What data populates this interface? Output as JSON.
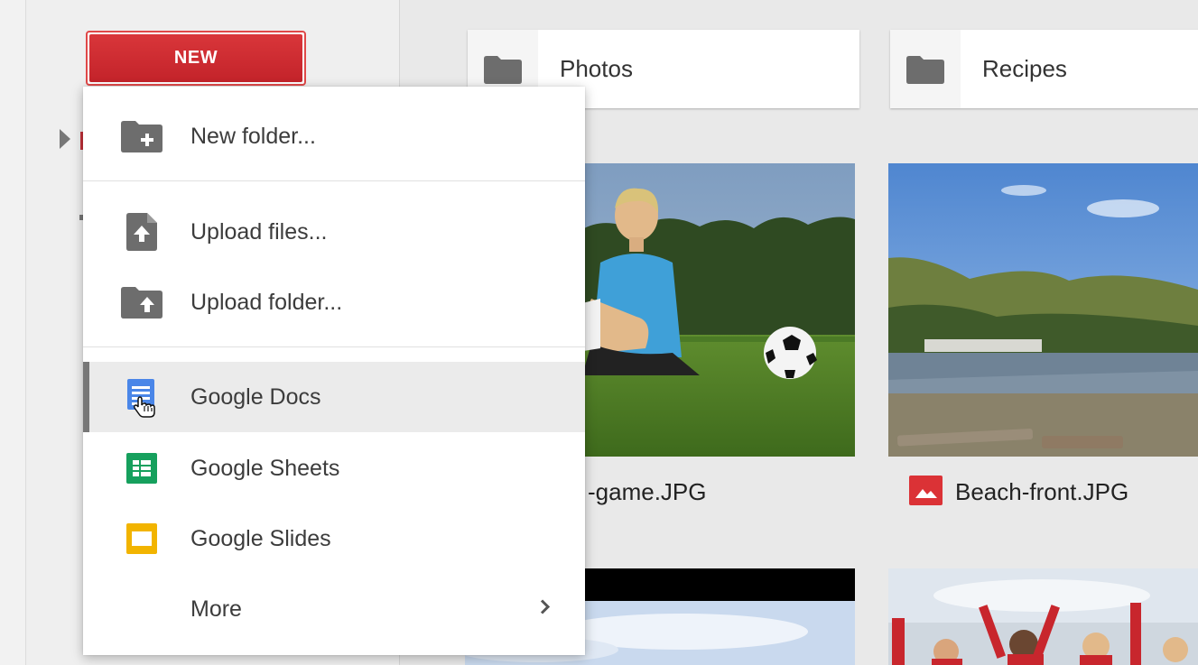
{
  "new_button": {
    "label": "NEW"
  },
  "menu": {
    "items": [
      {
        "label": "New folder...",
        "icon": "new-folder-icon"
      },
      {
        "label": "Upload files...",
        "icon": "upload-file-icon"
      },
      {
        "label": "Upload folder...",
        "icon": "upload-folder-icon"
      },
      {
        "label": "Google Docs",
        "icon": "google-docs-icon",
        "highlighted": true
      },
      {
        "label": "Google Sheets",
        "icon": "google-sheets-icon"
      },
      {
        "label": "Google Slides",
        "icon": "google-slides-icon"
      },
      {
        "label": "More",
        "icon": "chevron-right-icon"
      }
    ]
  },
  "folders": [
    {
      "name": "Photos",
      "icon": "folder-icon"
    },
    {
      "name": "Recipes",
      "icon": "folder-icon"
    }
  ],
  "files": [
    {
      "name": "-game.JPG"
    },
    {
      "name": "Beach-front.JPG",
      "icon": "image-file-icon"
    }
  ],
  "colors": {
    "new_button": "#c8262d",
    "docs": "#4a86e8",
    "sheets": "#16a05d",
    "slides": "#f2b400",
    "image_file": "#db3236"
  }
}
